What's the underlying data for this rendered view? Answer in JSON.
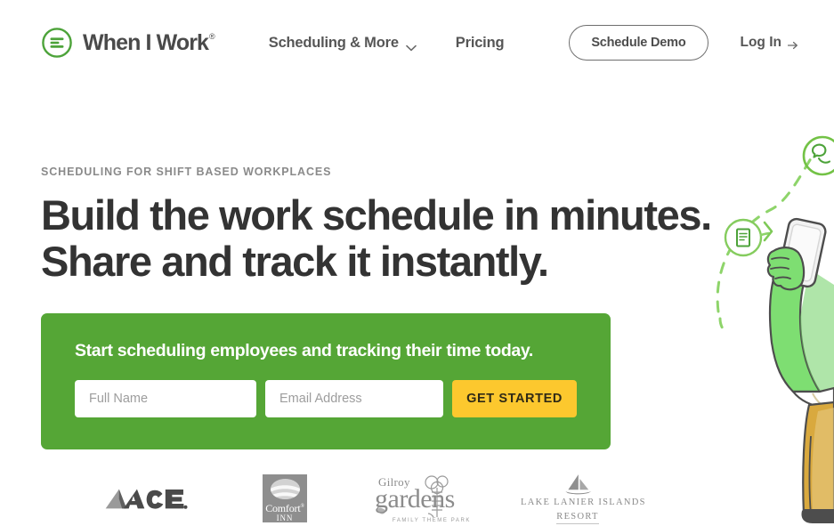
{
  "header": {
    "brand": {
      "name": "When I Work",
      "trademark": "®",
      "logo_icon": "when-i-work-mark"
    },
    "nav": [
      {
        "label": "Scheduling & More",
        "has_dropdown": true,
        "icon": "chevron-down-icon"
      },
      {
        "label": "Pricing",
        "has_dropdown": false
      }
    ],
    "demo_button": "Schedule Demo",
    "login": {
      "label": "Log In",
      "icon": "arrow-right-icon"
    }
  },
  "hero": {
    "eyebrow": "SCHEDULING FOR SHIFT BASED WORKPLACES",
    "headline_line1": "Build the work schedule in minutes.",
    "headline_line2": "Share and track it instantly."
  },
  "cta": {
    "title": "Start scheduling employees and tracking their time today.",
    "name_placeholder": "Full Name",
    "name_value": "",
    "email_placeholder": "Email Address",
    "email_value": "",
    "submit_label": "GET STARTED"
  },
  "logos": [
    {
      "name": "ace-logo",
      "text": "ACE"
    },
    {
      "name": "comfort-inn-logo",
      "word": "Comfort",
      "trademark": "®",
      "sub": "INN"
    },
    {
      "name": "gilroy-gardens-logo",
      "top": "Gilroy",
      "main": "gardens",
      "sub": "FAMILY THEME PARK"
    },
    {
      "name": "lake-lanier-islands-logo",
      "line1": "LAKE LANIER ISLANDS",
      "line2": "RESORT"
    }
  ],
  "illustration": {
    "name": "person-with-phone-illustration",
    "icons": [
      "document-icon",
      "chat-bubble-icon",
      "dashed-arrow"
    ]
  },
  "colors": {
    "brand_green": "#55a636",
    "cta_yellow": "#fcc82e",
    "text_dark": "#333333",
    "text_muted": "#8a8a8a",
    "logo_gray": "#8c8c8c"
  }
}
